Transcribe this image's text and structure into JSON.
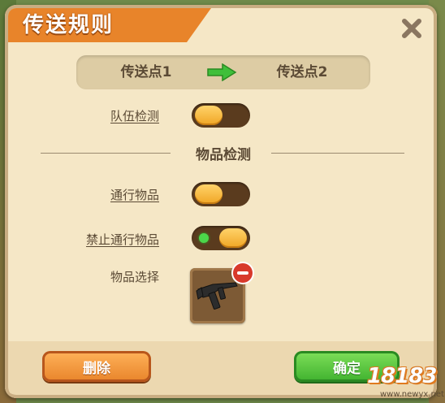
{
  "dialog": {
    "title": "传送规则",
    "close_icon": "close-icon"
  },
  "route": {
    "from": "传送点1",
    "to": "传送点2",
    "arrow_icon": "arrow-right-icon",
    "arrow_color": "#3fbf3a"
  },
  "team_check": {
    "label": "队伍检测",
    "enabled": false
  },
  "item_section": {
    "title": "物品检测"
  },
  "pass_items": {
    "label": "通行物品",
    "enabled": false
  },
  "forbid_items": {
    "label": "禁止通行物品",
    "enabled": true
  },
  "item_select": {
    "label": "物品选择",
    "item_icon": "submachine-gun-icon",
    "remove_icon": "remove-icon"
  },
  "footer": {
    "delete_label": "删除",
    "confirm_label": "确定"
  },
  "watermark": {
    "badge": "18183",
    "site": "www.newyx.net"
  },
  "colors": {
    "accent_orange": "#e8842a",
    "confirm_green": "#3fb12e",
    "panel_bg": "#f5e7c6"
  }
}
